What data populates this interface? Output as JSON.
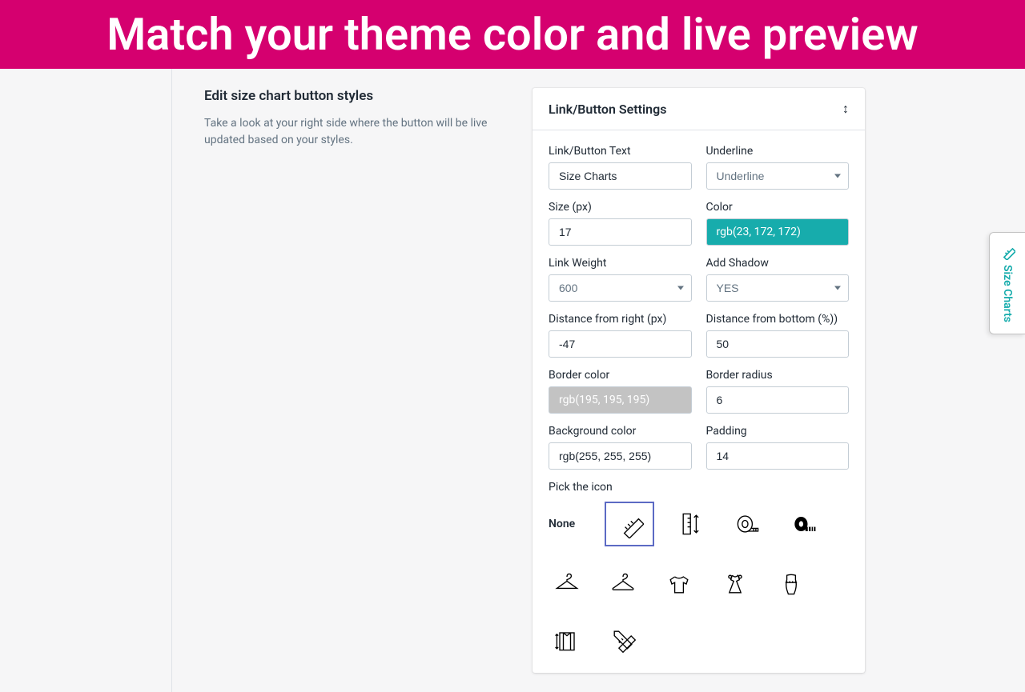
{
  "banner": {
    "text": "Match your theme color and live preview"
  },
  "left": {
    "title": "Edit size chart button styles",
    "desc": "Take a look at your right side where the button will be live updated based on your styles."
  },
  "settings": {
    "title": "Link/Button Settings",
    "fields": {
      "link_text": {
        "label": "Link/Button Text",
        "value": "Size Charts"
      },
      "underline": {
        "label": "Underline",
        "value": "Underline"
      },
      "size": {
        "label": "Size (px)",
        "value": "17"
      },
      "color": {
        "label": "Color",
        "value": "rgb(23, 172, 172)"
      },
      "weight": {
        "label": "Link Weight",
        "value": "600"
      },
      "shadow": {
        "label": "Add Shadow",
        "value": "YES"
      },
      "dist_right": {
        "label": "Distance from right (px)",
        "value": "-47"
      },
      "dist_bottom": {
        "label": "Distance from bottom (%))",
        "value": "50"
      },
      "border_color": {
        "label": "Border color",
        "value": "rgb(195, 195, 195)"
      },
      "border_radius": {
        "label": "Border radius",
        "value": "6"
      },
      "bg_color": {
        "label": "Background color",
        "value": "rgb(255, 255, 255)"
      },
      "padding": {
        "label": "Padding",
        "value": "14"
      },
      "pick_icon": {
        "label": "Pick the icon",
        "none": "None"
      }
    }
  },
  "floating": {
    "text": "Size Charts"
  }
}
